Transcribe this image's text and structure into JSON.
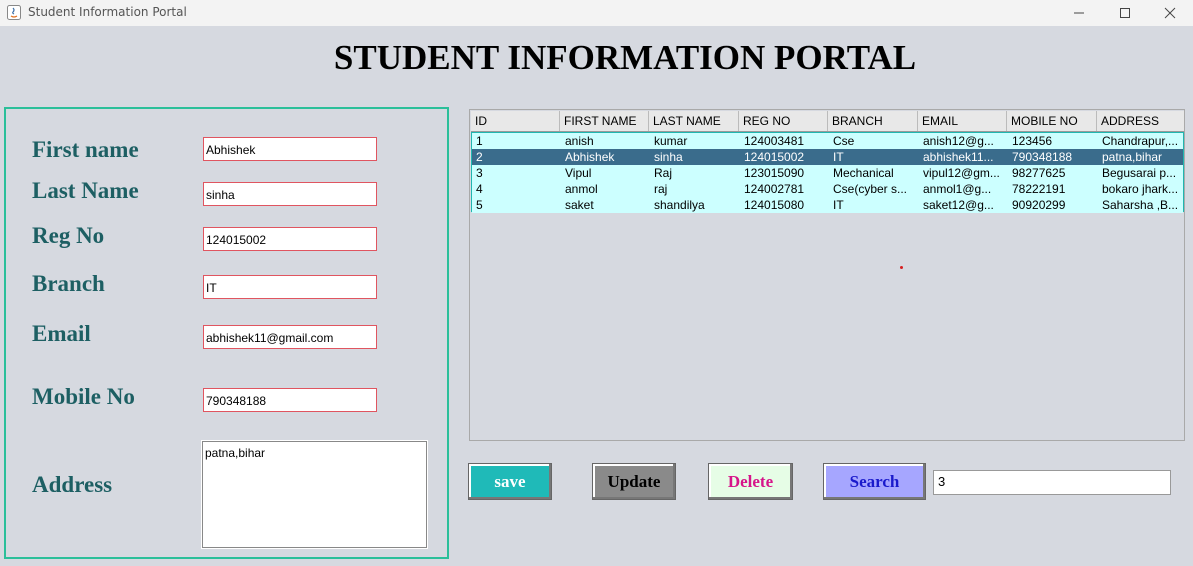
{
  "window": {
    "title": "Student Information Portal",
    "icon": "java-icon",
    "controls": [
      "minimize-icon",
      "maximize-icon",
      "close-icon"
    ]
  },
  "heading": "STUDENT INFORMATION PORTAL",
  "form": {
    "first_name_label": "First name",
    "first_name_value": "Abhishek",
    "last_name_label": "Last Name",
    "last_name_value": "sinha",
    "reg_no_label": "Reg No",
    "reg_no_value": "124015002",
    "branch_label": "Branch",
    "branch_value": "IT",
    "email_label": "Email",
    "email_value": "abhishek11@gmail.com",
    "mobile_label": "Mobile No",
    "mobile_value": "790348188",
    "address_label": "Address",
    "address_value": "patna,bihar"
  },
  "table": {
    "columns": [
      "ID",
      "FIRST NAME",
      "LAST NAME",
      "REG NO",
      "BRANCH",
      "EMAIL",
      "MOBILE NO",
      "ADDRESS"
    ],
    "selected_row": 1,
    "rows": [
      [
        "1",
        "anish",
        "kumar",
        "124003481",
        "Cse",
        "anish12@g...",
        "123456",
        "Chandrapur,..."
      ],
      [
        "2",
        "Abhishek",
        "sinha",
        "124015002",
        "IT",
        "abhishek11...",
        "790348188",
        "patna,bihar"
      ],
      [
        "3",
        "Vipul",
        "Raj",
        "123015090",
        "Mechanical",
        "vipul12@gm...",
        "98277625",
        "Begusarai p..."
      ],
      [
        "4",
        "anmol",
        "raj",
        "124002781",
        "Cse(cyber s...",
        "anmol1@g...",
        "78222191",
        "bokaro jhark..."
      ],
      [
        "5",
        "saket",
        "shandilya",
        "124015080",
        "IT",
        "saket12@g...",
        "90920299",
        "Saharsha ,B..."
      ]
    ]
  },
  "buttons": {
    "save": "save",
    "update": "Update",
    "delete": "Delete",
    "search": "Search"
  },
  "search_value": "3",
  "colors": {
    "background": "#d6d9e0",
    "label": "#1d5f63",
    "form_border": "#2bbf9a",
    "row_bg": "#ccffff",
    "row_selected": "#3a6c8c",
    "save_bg": "#1fbab8",
    "update_bg": "#8a8a8a",
    "delete_bg": "#e6fde6",
    "delete_text": "#d6158a",
    "search_bg": "#a6a6ff",
    "search_text": "#1a1acc"
  }
}
